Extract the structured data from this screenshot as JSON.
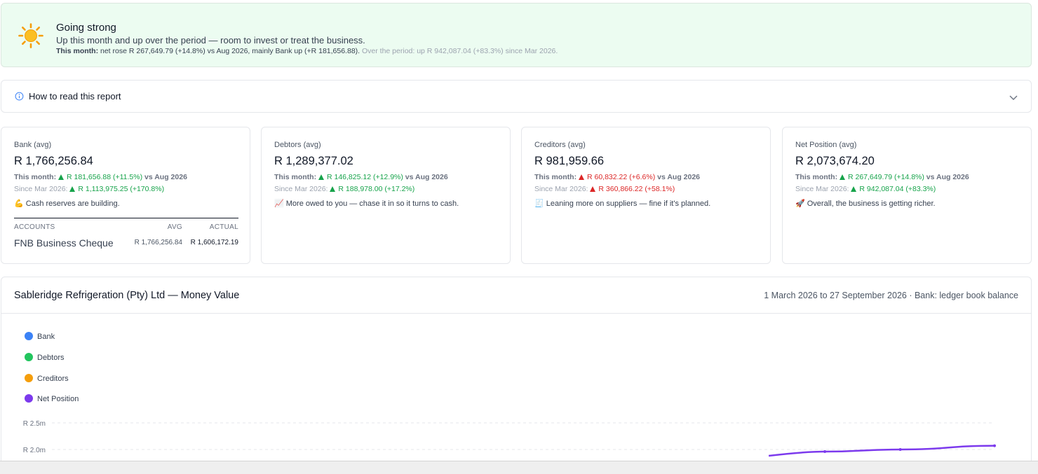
{
  "banner": {
    "title": "Going strong",
    "subtitle": "Up this month and up over the period — room to invest or treat the business.",
    "this_month_label": "This month:",
    "this_month_text": "net rose R 267,649.79 (+14.8%) vs Aug 2026, mainly Bank up (+R 181,656.88).",
    "period_text": "Over the period: up R 942,087.04 (+83.3%) since Mar 2026.",
    "icon": "sun-icon"
  },
  "howto": {
    "label": "How to read this report",
    "icon": "info-icon"
  },
  "cards": [
    {
      "title": "Bank (avg)",
      "value": "R 1,766,256.84",
      "month_label": "This month:",
      "month_change": "R 181,656.88 (+11.5%)",
      "month_vs": "vs Aug 2026",
      "month_dir": "up-good",
      "since_label": "Since Mar 2026:",
      "since_change": "R 1,113,975.25 (+170.8%)",
      "since_dir": "up-good",
      "note": "💪 Cash reserves are building.",
      "accounts": {
        "header_name": "ACCOUNTS",
        "header_avg": "AVG",
        "header_actual": "ACTUAL",
        "rows": [
          {
            "name": "FNB Business Cheque",
            "avg": "R 1,766,256.84",
            "actual": "R 1,606,172.19"
          }
        ]
      }
    },
    {
      "title": "Debtors (avg)",
      "value": "R 1,289,377.02",
      "month_label": "This month:",
      "month_change": "R 146,825.12 (+12.9%)",
      "month_vs": "vs Aug 2026",
      "month_dir": "up-good",
      "since_label": "Since Mar 2026:",
      "since_change": "R 188,978.00 (+17.2%)",
      "since_dir": "up-good",
      "note": "📈 More owed to you — chase it in so it turns to cash."
    },
    {
      "title": "Creditors (avg)",
      "value": "R 981,959.66",
      "month_label": "This month:",
      "month_change": "R 60,832.22 (+6.6%)",
      "month_vs": "vs Aug 2026",
      "month_dir": "up-bad",
      "since_label": "Since Mar 2026:",
      "since_change": "R 360,866.22 (+58.1%)",
      "since_dir": "up-bad",
      "note": "🧾 Leaning more on suppliers — fine if it's planned."
    },
    {
      "title": "Net Position (avg)",
      "value": "R 2,073,674.20",
      "month_label": "This month:",
      "month_change": "R 267,649.79 (+14.8%)",
      "month_vs": "vs Aug 2026",
      "month_dir": "up-good",
      "since_label": "Since Mar 2026:",
      "since_change": "R 942,087.04 (+83.3%)",
      "since_dir": "up-good",
      "note": "🚀 Overall, the business is getting richer."
    }
  ],
  "chart_panel": {
    "title": "Sableridge Refrigeration (Pty) Ltd — Money Value",
    "range": "1 March 2026 to 27 September 2026 · Bank: ledger book balance"
  },
  "chart_data": {
    "type": "line",
    "series": [
      {
        "name": "Bank",
        "color": "#3b82f6",
        "values": []
      },
      {
        "name": "Debtors",
        "color": "#22c55e",
        "values": []
      },
      {
        "name": "Creditors",
        "color": "#f59e0b",
        "values": []
      },
      {
        "name": "Net Position",
        "color": "#7c3aed",
        "values": [
          1960000,
          2000000,
          2070000
        ]
      }
    ],
    "x_positions_fraction": [
      0.82,
      0.9,
      1.0
    ],
    "y_ticks": [
      {
        "label": "R 2.5m",
        "value": 2500000
      },
      {
        "label": "R 2.0m",
        "value": 2000000
      }
    ],
    "grid": true,
    "legend": "top-left"
  }
}
